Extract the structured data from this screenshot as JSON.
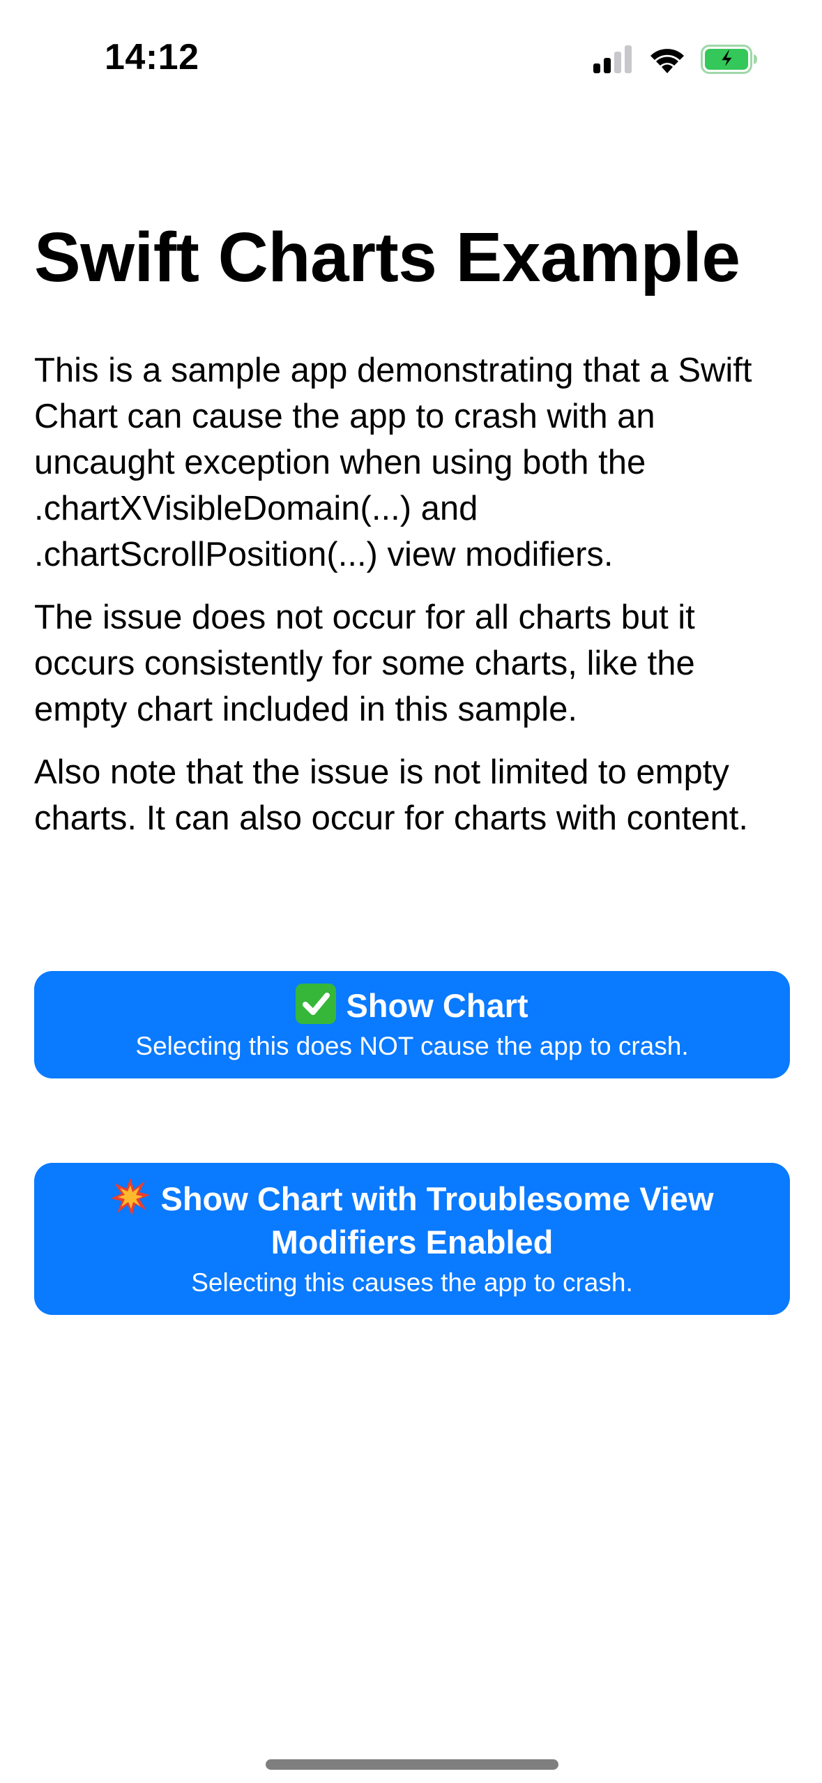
{
  "status_bar": {
    "time": "14:12",
    "icons": [
      "cellular-signal-icon",
      "wifi-icon",
      "battery-charging-icon"
    ],
    "battery_color": "#34c759"
  },
  "main": {
    "title": "Swift Charts Example",
    "paragraphs": [
      "This is a sample app demonstrating that a Swift Chart can cause the app to crash with an uncaught exception when using both the .chartXVisibleDomain(...) and .chartScrollPosition(...) view modifiers.",
      "The issue does not occur for all charts but it occurs consistently for some charts, like the empty chart included in this sample.",
      "Also note that the issue is not limited to empty charts. It can also occur for charts with content."
    ],
    "buttons": {
      "show_chart": {
        "icon": "check-mark-emoji-icon",
        "title": "Show Chart",
        "subtitle": "Selecting this does NOT cause the app to crash."
      },
      "troublesome": {
        "icon": "collision-emoji-icon",
        "title": "Show Chart with Troublesome View Modifiers Enabled",
        "subtitle": "Selecting this causes the app to crash."
      }
    }
  },
  "colors": {
    "accent": "#0a7aff",
    "text": "#000000",
    "background": "#ffffff"
  }
}
